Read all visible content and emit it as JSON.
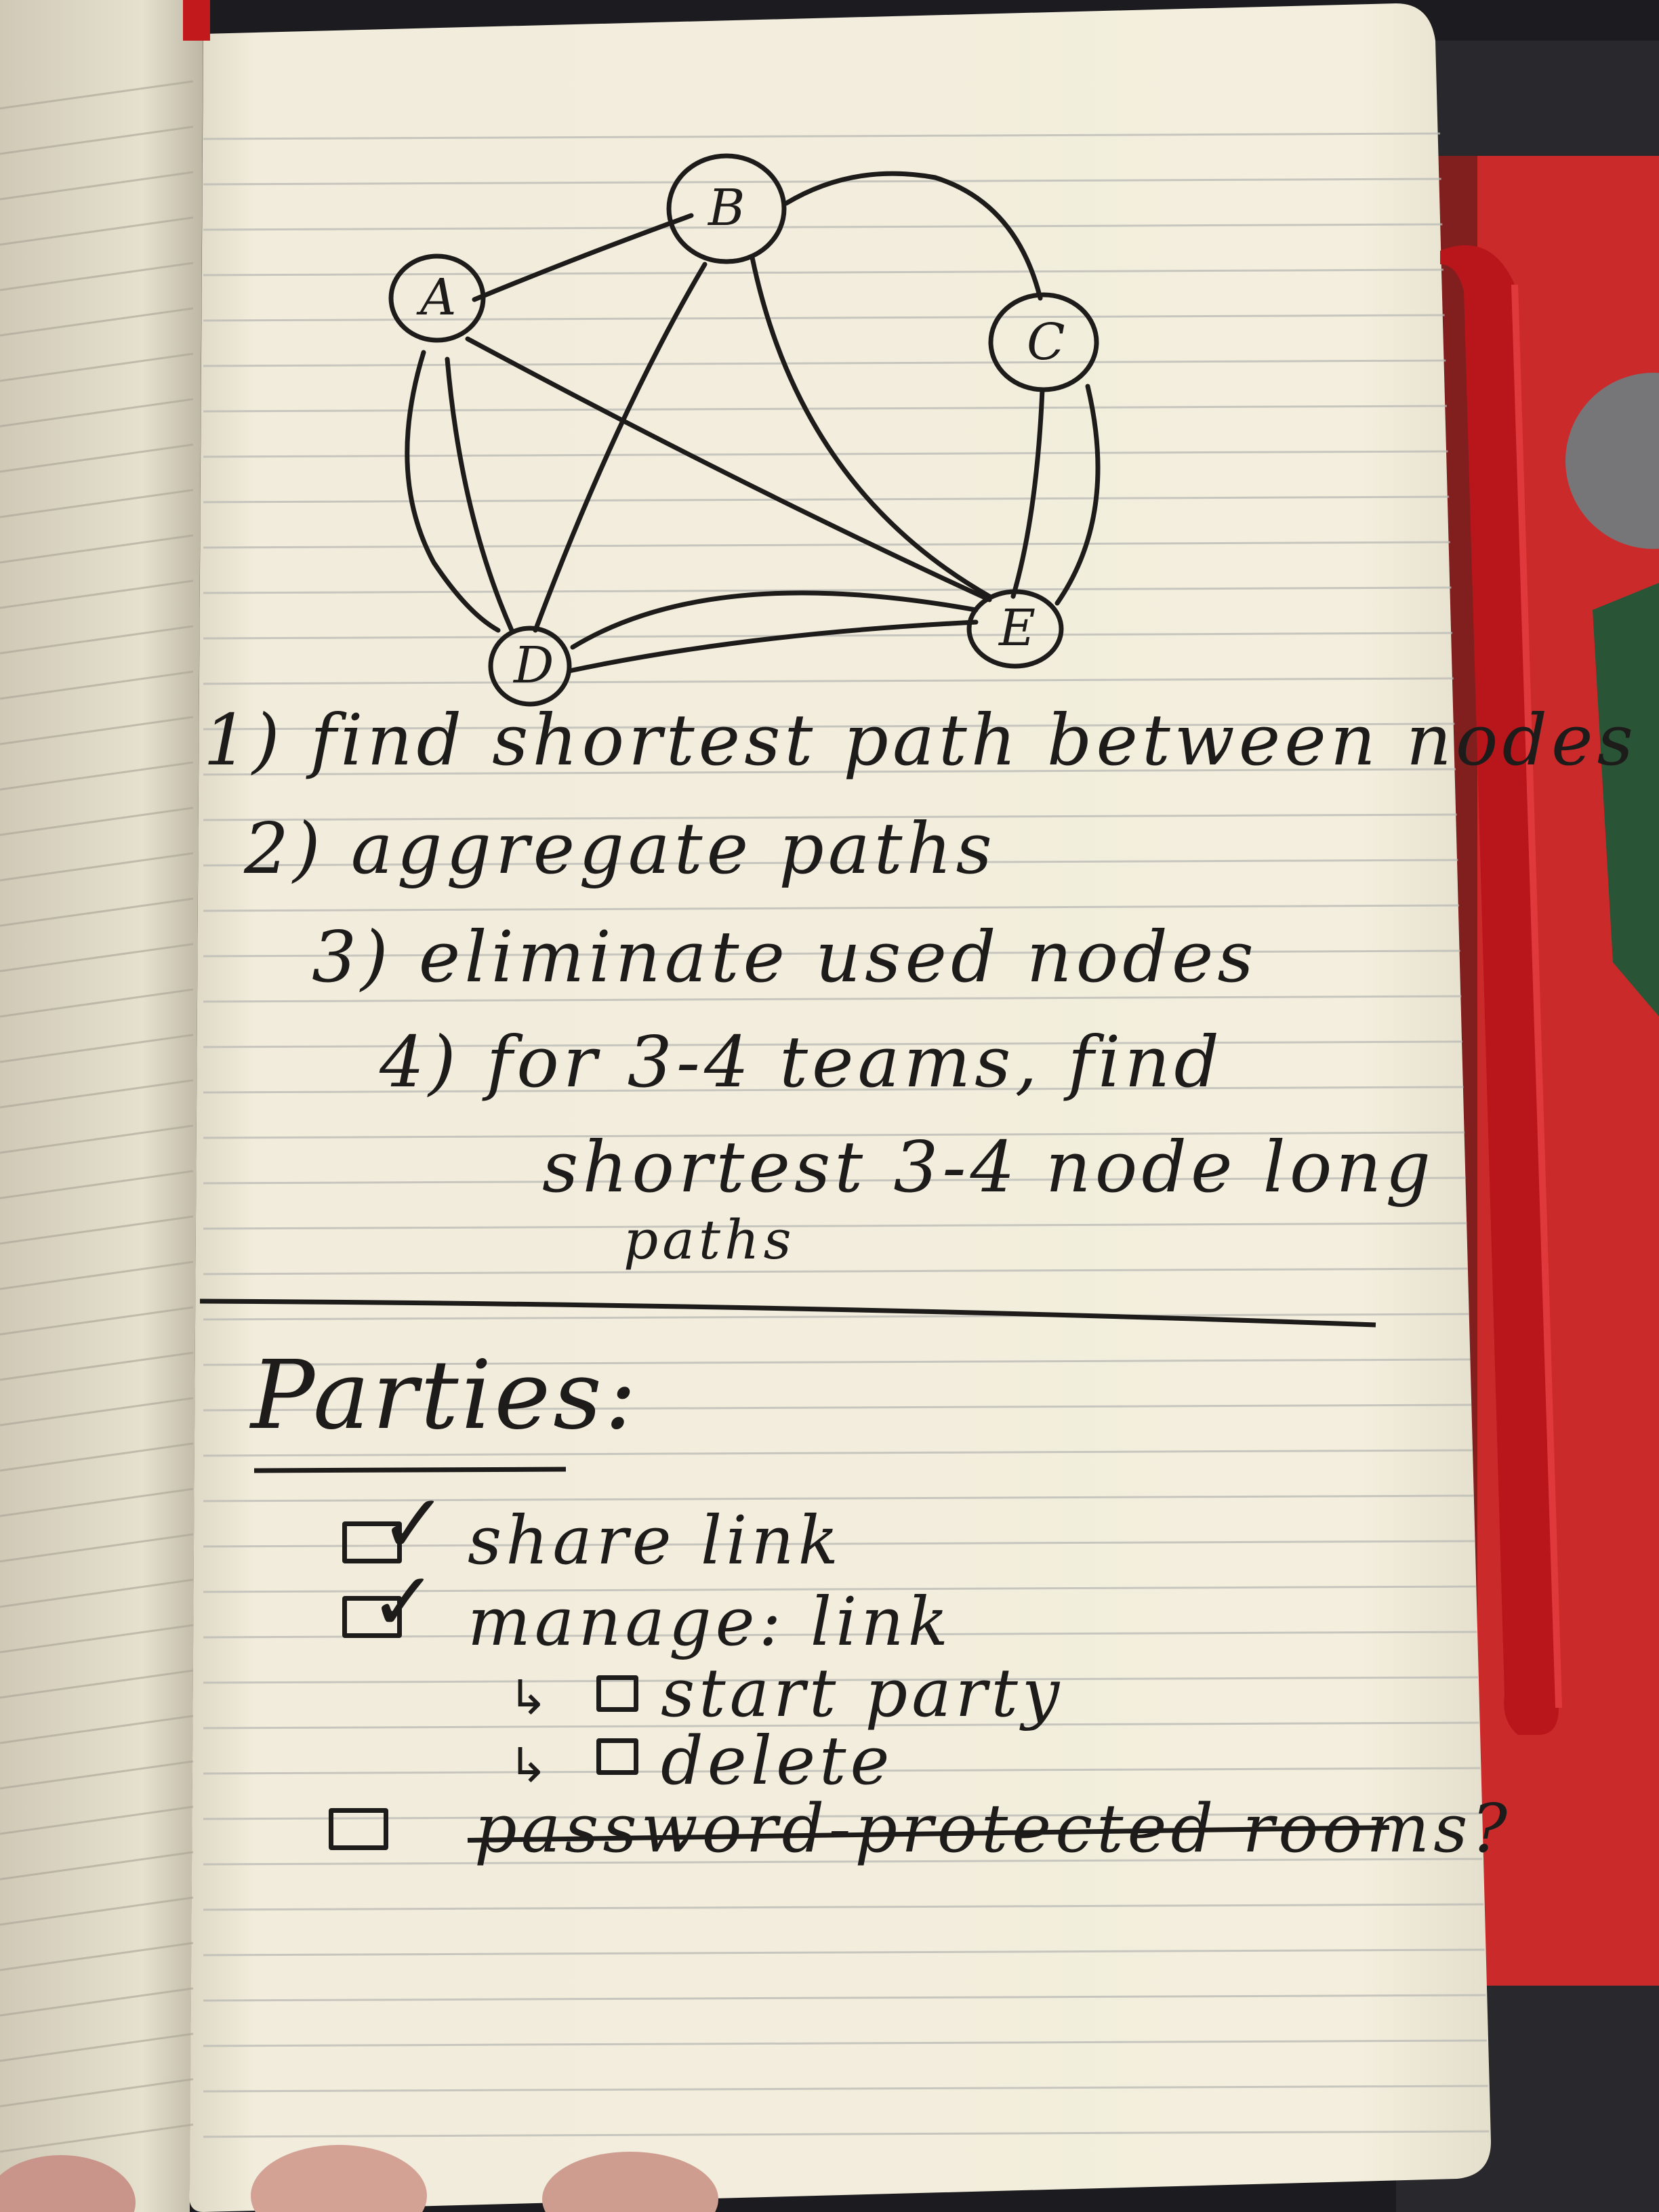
{
  "graph": {
    "nodes": [
      "A",
      "B",
      "C",
      "D",
      "E"
    ],
    "edges": [
      [
        "A",
        "B"
      ],
      [
        "A",
        "E"
      ],
      [
        "A",
        "D"
      ],
      [
        "B",
        "C"
      ],
      [
        "B",
        "D"
      ],
      [
        "B",
        "E"
      ],
      [
        "C",
        "E"
      ],
      [
        "D",
        "E"
      ]
    ]
  },
  "notes": {
    "step1": "1) find shortest path between nodes",
    "step2": "2) aggregate paths",
    "step3": "3) eliminate used nodes",
    "step4_line1": "4) for 3-4 teams, find",
    "step4_line2": "shortest 3-4 node long",
    "step4_line3": "paths"
  },
  "parties": {
    "heading": "Parties:",
    "items": [
      {
        "label": "share link",
        "checked": true
      },
      {
        "label": "manage: link",
        "checked": true
      },
      {
        "label": "start party",
        "checked": true
      },
      {
        "label": "delete",
        "checked": true
      },
      {
        "label": "password-protected rooms?",
        "checked": false,
        "struck_through": true
      }
    ]
  },
  "colors": {
    "ink": "#1e1c1a",
    "paper": "#f4efdf",
    "bookmark_ribbon": "#c8171c",
    "book_cover": "#d31f1f"
  }
}
